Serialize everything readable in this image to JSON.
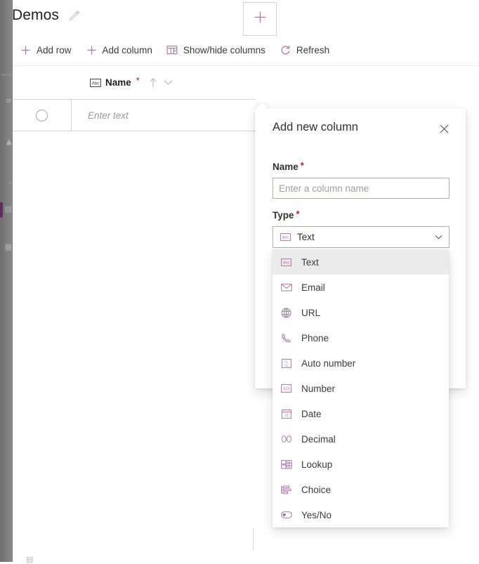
{
  "colors": {
    "accent": "#a4799f",
    "accent_dark": "#5c2d5f",
    "required_star": "#a4262c",
    "text": "#323130",
    "text_muted": "#a19f9d",
    "border": "#d6d4d2",
    "rail_bg": "#7a7a7a",
    "selected_row_bg": "#ebebeb"
  },
  "rail": {
    "items": [
      {
        "name": "menu-icon",
        "glyph": "≡"
      },
      {
        "name": "home-icon",
        "glyph": "▲"
      },
      {
        "name": "recent-icon",
        "glyph": "–"
      },
      {
        "name": "tables-icon",
        "glyph": "▤"
      },
      {
        "name": "apps-icon",
        "glyph": "▦"
      }
    ]
  },
  "header": {
    "title": "Demos",
    "edit_icon": "pencil-icon"
  },
  "toolbar": {
    "commands": [
      {
        "label": "Add row",
        "icon": "plus-icon"
      },
      {
        "label": "Add column",
        "icon": "plus-icon"
      },
      {
        "label": "Show/hide columns",
        "icon": "columns-icon"
      },
      {
        "label": "Refresh",
        "icon": "refresh-icon"
      }
    ]
  },
  "grid": {
    "columns": [
      {
        "label": "Name",
        "required_marker": "*",
        "type_icon": "abc-text-icon",
        "sort_icon": "sort-ascending-icon",
        "menu_icon": "chevron-down-icon"
      }
    ],
    "add_column_button": {
      "name": "add-column-cell-button",
      "icon": "plus-icon"
    },
    "rows": [
      {
        "select_icon": "row-select-circle",
        "cells": [
          {
            "placeholder": "Enter text",
            "value": ""
          }
        ]
      }
    ]
  },
  "dialog": {
    "title": "Add new column",
    "close_icon": "close-icon",
    "name_field": {
      "label": "Name",
      "required_marker": "*",
      "placeholder": "Enter a column name",
      "value": ""
    },
    "type_field": {
      "label": "Type",
      "required_marker": "*",
      "selected": "Text",
      "selected_icon": "abc-text-icon",
      "caret_icon": "chevron-down-icon",
      "expanded": true
    }
  },
  "type_dropdown": {
    "options": [
      {
        "label": "Text",
        "icon": "abc-text-icon",
        "selected": true
      },
      {
        "label": "Email",
        "icon": "envelope-icon",
        "selected": false
      },
      {
        "label": "URL",
        "icon": "globe-icon",
        "selected": false
      },
      {
        "label": "Phone",
        "icon": "phone-icon",
        "selected": false
      },
      {
        "label": "Auto number",
        "icon": "auto-number-icon",
        "selected": false
      },
      {
        "label": "Number",
        "icon": "number-123-icon",
        "selected": false
      },
      {
        "label": "Date",
        "icon": "calendar-icon",
        "selected": false
      },
      {
        "label": "Decimal",
        "icon": "decimal-00-icon",
        "selected": false
      },
      {
        "label": "Lookup",
        "icon": "lookup-icon",
        "selected": false
      },
      {
        "label": "Choice",
        "icon": "choice-list-icon",
        "selected": false
      },
      {
        "label": "Yes/No",
        "icon": "toggle-icon",
        "selected": false
      }
    ]
  },
  "footer": {
    "glyph": "▤"
  }
}
